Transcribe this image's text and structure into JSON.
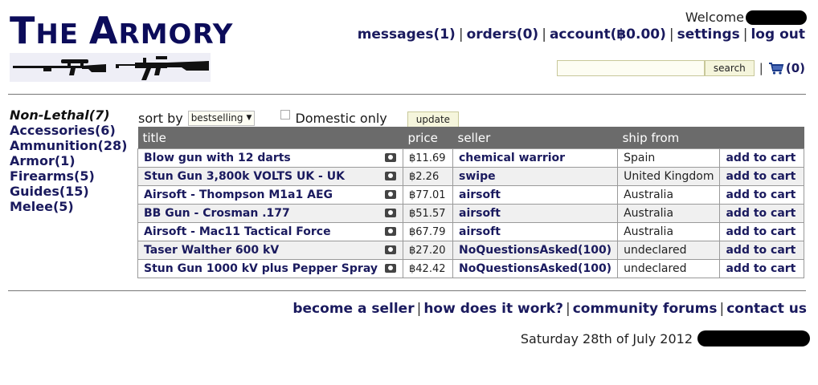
{
  "brand": {
    "title_initial1": "T",
    "title_word1_rest": "HE ",
    "title_initial2": "A",
    "title_word2_rest": "RMORY"
  },
  "header": {
    "welcome_label": "Welcome",
    "nav": {
      "messages": "messages(1)",
      "orders": "orders(0)",
      "account": "account(฿0.00)",
      "settings": "settings",
      "logout": "log out"
    },
    "separator": "|",
    "search_button": "search",
    "search_value": "",
    "cart_count": "(0)"
  },
  "sidebar": {
    "items": [
      {
        "label": "Non-Lethal(7)"
      },
      {
        "label": "Accessories(6)"
      },
      {
        "label": "Ammunition(28)"
      },
      {
        "label": "Armor(1)"
      },
      {
        "label": "Firearms(5)"
      },
      {
        "label": "Guides(15)"
      },
      {
        "label": "Melee(5)"
      }
    ]
  },
  "sortbar": {
    "label": "sort by",
    "selected": "bestselling",
    "domestic_label": "Domestic only",
    "update_button": "update"
  },
  "table": {
    "columns": [
      "title",
      "price",
      "seller",
      "ship from",
      ""
    ],
    "rows": [
      {
        "title": "Blow gun with 12 darts",
        "price": "฿11.69",
        "seller": "chemical warrior",
        "ship_from": "Spain",
        "action": "add to cart"
      },
      {
        "title": "Stun Gun 3,800k VOLTS UK - UK",
        "price": "฿2.26",
        "seller": "swipe",
        "ship_from": "United Kingdom",
        "action": "add to cart"
      },
      {
        "title": "Airsoft - Thompson M1a1 AEG",
        "price": "฿77.01",
        "seller": "airsoft",
        "ship_from": "Australia",
        "action": "add to cart"
      },
      {
        "title": "BB Gun - Crosman .177",
        "price": "฿51.57",
        "seller": "airsoft",
        "ship_from": "Australia",
        "action": "add to cart"
      },
      {
        "title": "Airsoft - Mac11 Tactical Force",
        "price": "฿67.79",
        "seller": "airsoft",
        "ship_from": "Australia",
        "action": "add to cart"
      },
      {
        "title": "Taser Walther 600 kV",
        "price": "฿27.20",
        "seller": "NoQuestionsAsked(100)",
        "ship_from": "undeclared",
        "action": "add to cart"
      },
      {
        "title": "Stun Gun 1000 kV plus Pepper Spray",
        "price": "฿42.42",
        "seller": "NoQuestionsAsked(100)",
        "ship_from": "undeclared",
        "action": "add to cart"
      }
    ]
  },
  "footer": {
    "links": {
      "seller": "become a seller",
      "how": "how does it work?",
      "forums": "community forums",
      "contact": "contact us"
    },
    "date": "Saturday 28th of July 2012"
  },
  "colors": {
    "brand": "#0c0c5a",
    "link": "#1a1a5e",
    "table_header": "#6b6b6b",
    "button_bg": "#f5f5dc"
  }
}
